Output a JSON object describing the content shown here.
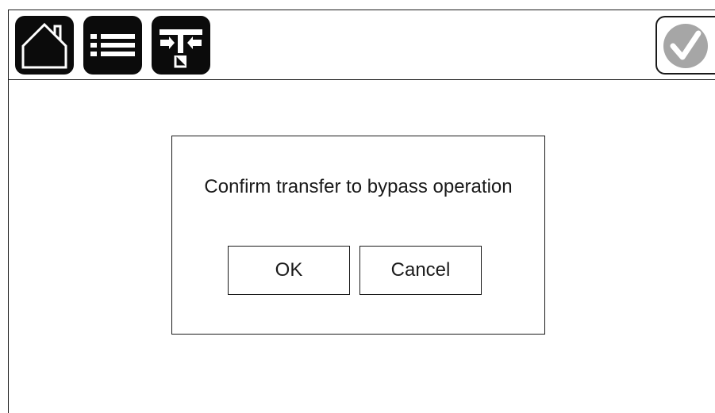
{
  "toolbar": {
    "home_icon": "home-icon",
    "menu_icon": "list-menu-icon",
    "bypass_icon": "bypass-transfer-icon",
    "status_icon": "check-mark-icon",
    "status_color": "#a6a6a6"
  },
  "dialog": {
    "message": "Confirm transfer to bypass operation",
    "ok_label": "OK",
    "cancel_label": "Cancel"
  },
  "colors": {
    "button_fill": "#0b0b0b",
    "line": "#1a1a1a",
    "background": "#ffffff"
  }
}
